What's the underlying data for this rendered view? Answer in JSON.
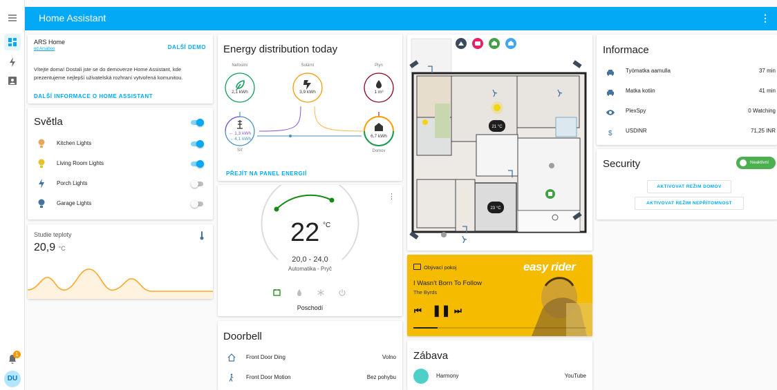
{
  "app": {
    "title": "Home Assistant",
    "more_icon": "dots-vertical-icon"
  },
  "sidebar": {
    "items": [
      {
        "icon": "menu-icon"
      },
      {
        "icon": "dashboard-icon",
        "active": true
      },
      {
        "icon": "lightning-icon"
      },
      {
        "icon": "account-box-icon"
      }
    ],
    "notifications": {
      "icon": "bell-icon",
      "count": "1"
    },
    "user": {
      "initials": "DU"
    }
  },
  "welcome": {
    "title": "ARS Home",
    "subtitle": "od Arsaboo",
    "demo_button": "DALŠÍ DEMO",
    "description": "Vítejte doma! Dostali jste se do demoverze Home Assistant, kde prezentujeme nejlepší uživatelská rozhraní vytvořená komunitou.",
    "more_link": "DALŠÍ INFORMACE O HOME ASSISTANT"
  },
  "lights": {
    "title": "Světla",
    "master_on": true,
    "items": [
      {
        "label": "Kitchen Lights",
        "on": true,
        "color": "#e8a85c"
      },
      {
        "label": "Living Room Lights",
        "on": true,
        "color": "#e6c229"
      },
      {
        "label": "Porch Lights",
        "on": false,
        "color": "#44739e"
      },
      {
        "label": "Garage Lights",
        "on": false,
        "color": "#44739e"
      }
    ]
  },
  "temp_study": {
    "label": "Studie teploty",
    "value": "20,9",
    "unit": "°C"
  },
  "energy": {
    "title": "Energy distribution today",
    "nodes": {
      "fossil": {
        "label": "Nefosilní",
        "value": "2,1 kWh"
      },
      "solar": {
        "label": "Solární",
        "value": "3,9 kWh"
      },
      "gas": {
        "label": "Plyn",
        "value": "1 m³"
      },
      "grid": {
        "label": "Síť",
        "in": "← 1,3 kWh",
        "out": "→ 4,1 kWh"
      },
      "home": {
        "label": "Domov",
        "value": "6,7 kWh"
      }
    },
    "link": "PŘEJÍT NA PANEL ENERGIÍ"
  },
  "thermostat": {
    "current": "22",
    "unit": "°C",
    "range": "20,0 - 24,0",
    "mode": "Automatika - Pryč",
    "name": "Poschodí"
  },
  "doorbell": {
    "title": "Doorbell",
    "items": [
      {
        "label": "Front Door Ding",
        "state": "Volno",
        "icon": "home-outline-icon"
      },
      {
        "label": "Front Door Motion",
        "state": "Bez pohybu",
        "icon": "walk-icon"
      }
    ]
  },
  "floorplan": {
    "temps": [
      "21 °C",
      "23 °C"
    ]
  },
  "media": {
    "device": "Obývací pokoj",
    "song": "I Wasn't Born To Follow",
    "artist": "The Byrds",
    "progress": 0.14,
    "brand": "easy rider"
  },
  "entertainment": {
    "title": "Zábava",
    "item": {
      "label": "Harmony",
      "state": "YouTube"
    }
  },
  "info": {
    "title": "Informace",
    "items": [
      {
        "label": "Työmatka aamulla",
        "state": "37 min",
        "icon": "car-icon"
      },
      {
        "label": "Matka kotiin",
        "state": "41 min",
        "icon": "car-icon"
      },
      {
        "label": "PlexSpy",
        "state": "0 Watching",
        "icon": "eye-icon"
      },
      {
        "label": "USDINR",
        "state": "71,25 INR",
        "icon": "currency-usd-icon"
      }
    ]
  },
  "security": {
    "title": "Security",
    "state": "Neaktivní",
    "btn_home": "AKTIVOVAT REŽIM DOMOV",
    "btn_away": "AKTIVOVAT REŽIM NEPŘÍTOMNOST"
  },
  "colors": {
    "primary": "#03a9f4",
    "solar": "#ff9800",
    "grid": "#488fc2",
    "gas": "#8e021b",
    "fossil": "#0f9d58",
    "grid_return": "#8353d4",
    "thermo_arc": "#138a13",
    "media_bg": "#f5bb00"
  }
}
